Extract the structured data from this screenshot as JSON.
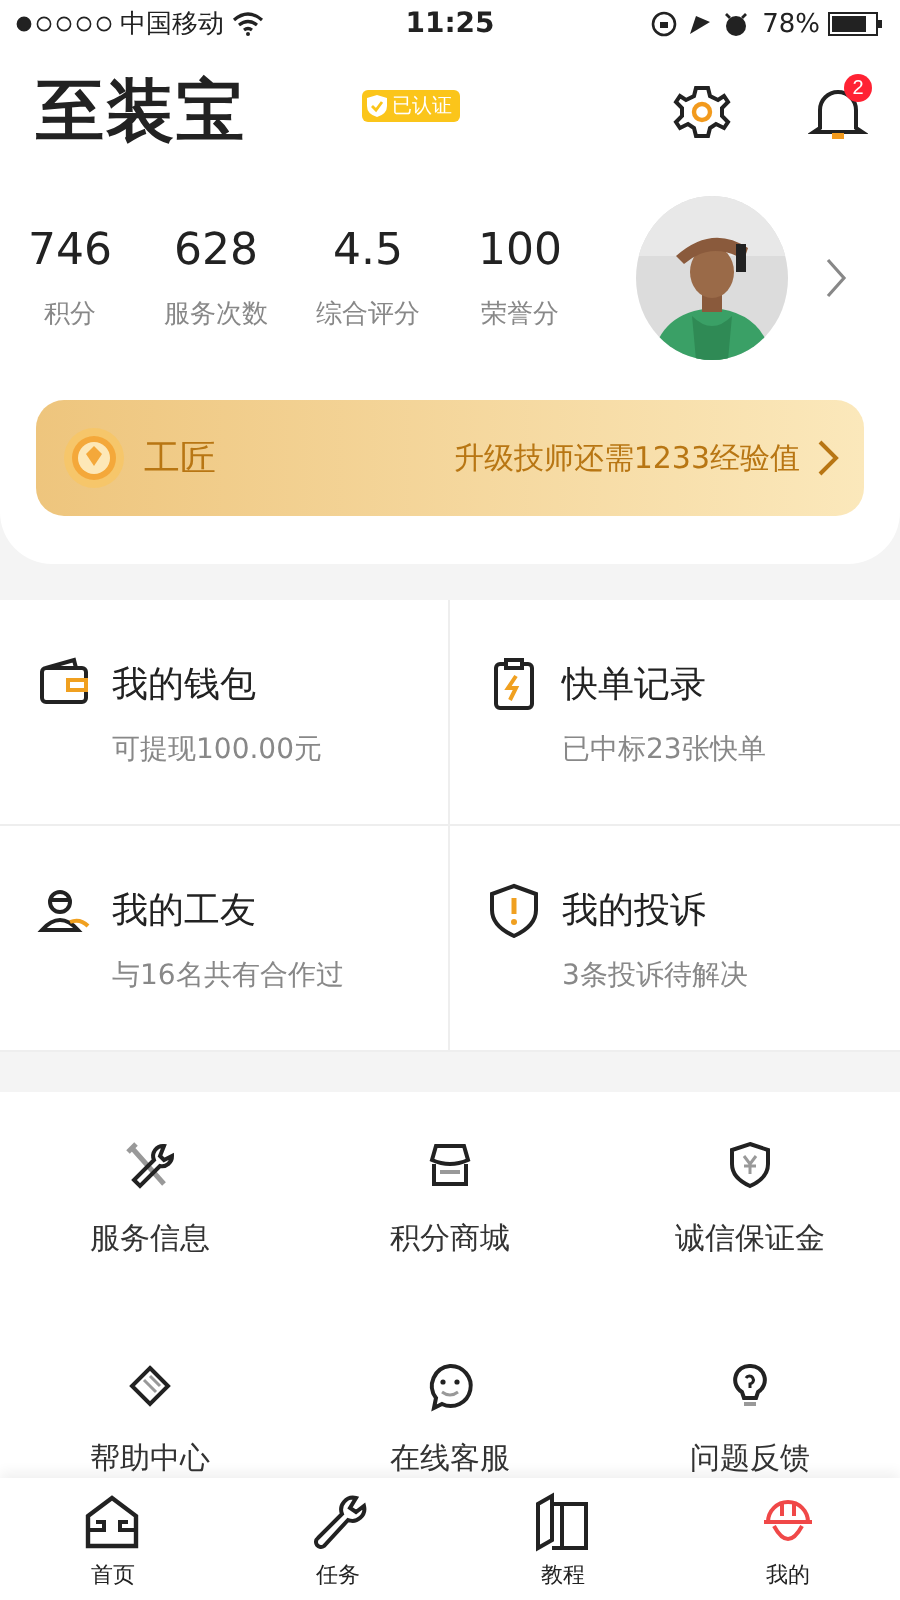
{
  "status_bar": {
    "carrier": "中国移动",
    "time": "11:25",
    "battery": "78%"
  },
  "header": {
    "title": "至装宝",
    "badge": "已认证",
    "notification_count": "2"
  },
  "stats": [
    {
      "value": "746",
      "label": "积分"
    },
    {
      "value": "628",
      "label": "服务次数"
    },
    {
      "value": "4.5",
      "label": "综合评分"
    },
    {
      "value": "100",
      "label": "荣誉分"
    }
  ],
  "level_banner": {
    "rank": "工匠",
    "message": "升级技师还需1233经验值"
  },
  "cards": [
    {
      "title": "我的钱包",
      "subtitle": "可提现100.00元"
    },
    {
      "title": "快单记录",
      "subtitle": "已中标23张快单"
    },
    {
      "title": "我的工友",
      "subtitle": "与16名共有合作过"
    },
    {
      "title": "我的投诉",
      "subtitle": "3条投诉待解决"
    }
  ],
  "services": [
    {
      "label": "服务信息"
    },
    {
      "label": "积分商城"
    },
    {
      "label": "诚信保证金"
    },
    {
      "label": "帮助中心"
    },
    {
      "label": "在线客服"
    },
    {
      "label": "问题反馈"
    }
  ],
  "tabs": [
    {
      "label": "首页",
      "selected": false
    },
    {
      "label": "任务",
      "selected": false
    },
    {
      "label": "教程",
      "selected": false
    },
    {
      "label": "我的",
      "selected": true
    }
  ]
}
